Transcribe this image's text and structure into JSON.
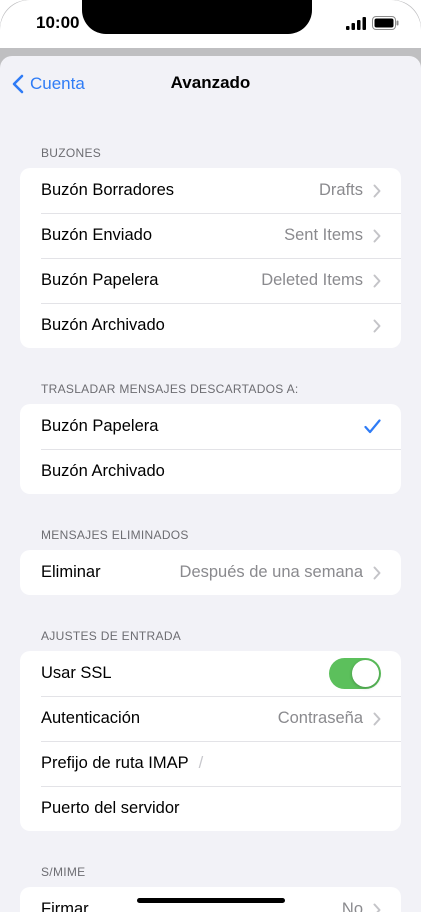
{
  "status": {
    "time": "10:00"
  },
  "nav": {
    "back_label": "Cuenta",
    "title": "Avanzado"
  },
  "sections": {
    "buzones": {
      "header": "BUZONES",
      "rows": [
        {
          "label": "Buzón Borradores",
          "value": "Drafts"
        },
        {
          "label": "Buzón Enviado",
          "value": "Sent Items"
        },
        {
          "label": "Buzón Papelera",
          "value": "Deleted Items"
        },
        {
          "label": "Buzón Archivado",
          "value": ""
        }
      ]
    },
    "trasladar": {
      "header": "TRASLADAR MENSAJES DESCARTADOS A:",
      "rows": [
        {
          "label": "Buzón Papelera",
          "selected": true
        },
        {
          "label": "Buzón Archivado",
          "selected": false
        }
      ]
    },
    "eliminados": {
      "header": "MENSAJES ELIMINADOS",
      "rows": [
        {
          "label": "Eliminar",
          "value": "Después de una semana"
        }
      ]
    },
    "entrada": {
      "header": "AJUSTES DE ENTRADA",
      "rows": [
        {
          "label": "Usar SSL",
          "toggle_on": true
        },
        {
          "label": "Autenticación",
          "value": "Contraseña"
        },
        {
          "label": "Prefijo de ruta IMAP",
          "value": "/"
        },
        {
          "label": "Puerto del servidor",
          "value": ""
        }
      ]
    },
    "smime": {
      "header": "S/MIME",
      "rows": [
        {
          "label": "Firmar",
          "value": "No"
        }
      ]
    }
  },
  "colors": {
    "accent": "#2f7cf6",
    "toggle_on": "#5cc05c",
    "background": "#f2f2f7"
  }
}
